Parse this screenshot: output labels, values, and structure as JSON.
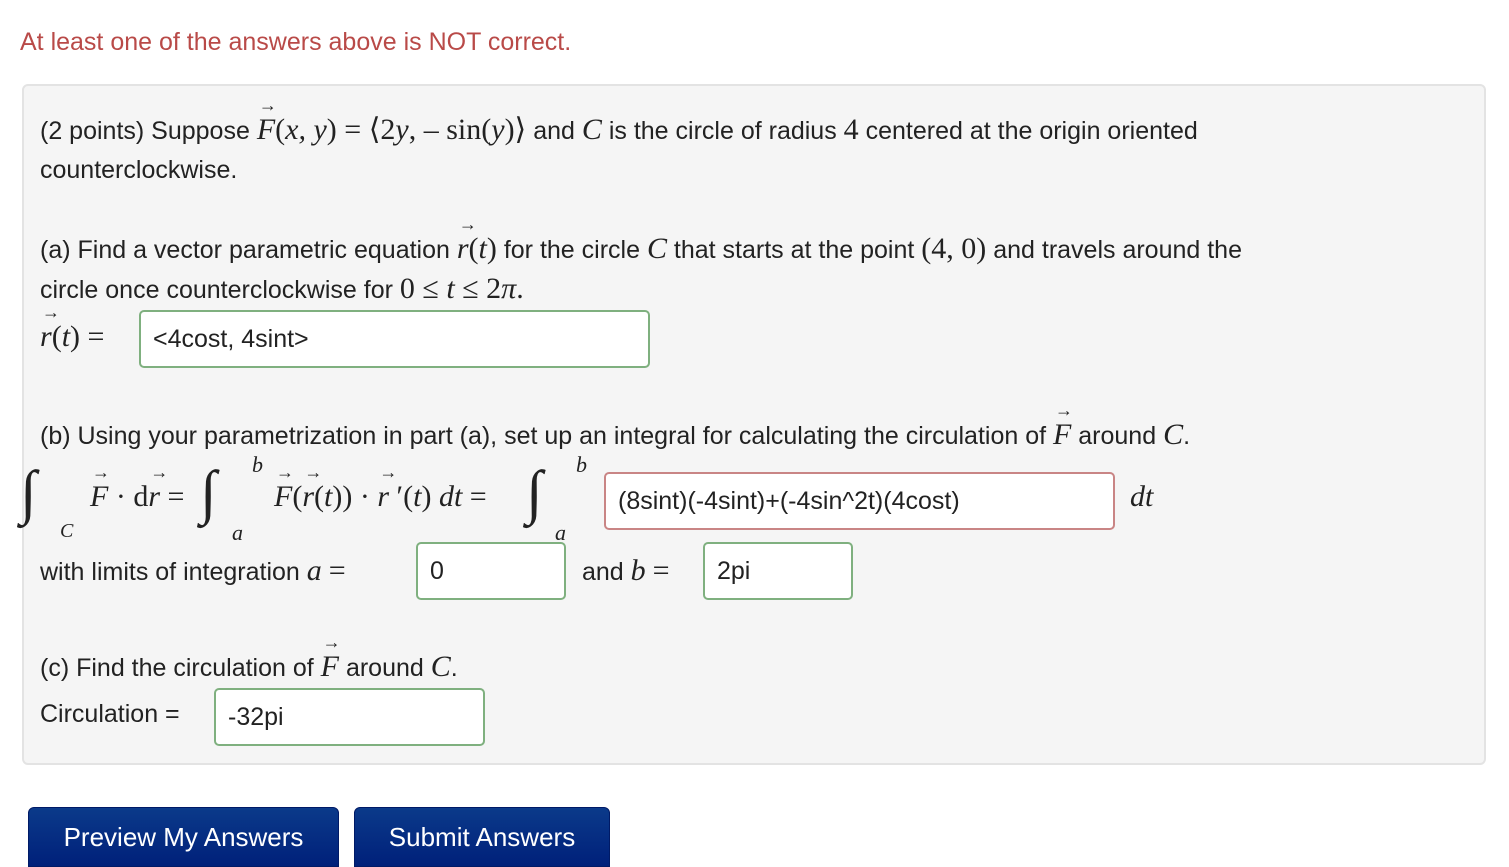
{
  "alert": "At least one of the answers above is NOT correct.",
  "problem": {
    "points": "(2 points) Suppose",
    "field": "F(x, y) = ⟨2y, – sin(y)⟩",
    "intro_rest": "and C is the circle of radius 4 centered at the origin oriented",
    "intro_line2": "counterclockwise.",
    "part_a": {
      "line1": "(a) Find a vector parametric equation r(t) for the circle C that starts at the point (4, 0) and travels around the",
      "line2": "circle once counterclockwise for 0 ≤ t ≤ 2π.",
      "label": "r(t) =",
      "answer": "<4cost, 4sint>",
      "status": "correct"
    },
    "part_b": {
      "line1": "(b) Using your parametrization in part (a), set up an integral for calculating the circulation of F around C.",
      "integral_lhs": "F · dr =",
      "integral_mid": "F(r(t)) · r ′(t) dt =",
      "answer": "(8sint)(-4sint)+(-4sin^2t)(4cost)",
      "answer_status": "incorrect",
      "dt": "dt",
      "limits_label": "with limits of integration a =",
      "a_value": "0",
      "and_b": "and b =",
      "b_value": "2pi"
    },
    "part_c": {
      "line1": "(c) Find the circulation of F around C.",
      "label": "Circulation =",
      "answer": "-32pi",
      "status": "correct"
    }
  },
  "buttons": {
    "preview": "Preview My Answers",
    "submit": "Submit Answers"
  }
}
